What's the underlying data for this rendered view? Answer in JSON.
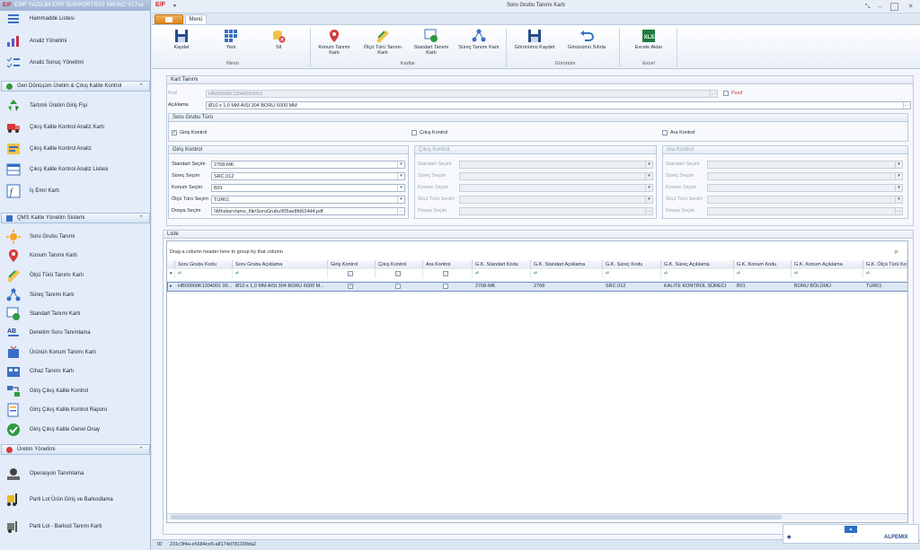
{
  "app": {
    "title": "EMF YAZILIM ERP SUPPORTSV2 MIKRO V17xx",
    "logo": "E/F"
  },
  "sidebar": {
    "top_items": [
      {
        "label": "Hammadde Listesi",
        "icon": "list-icon"
      },
      {
        "label": "Analiz Yönetimi",
        "icon": "chart-icon"
      },
      {
        "label": "Analiz Sonuç Yönetimi",
        "icon": "checklist-icon"
      }
    ],
    "groups": [
      {
        "label": "Geri Dönüşüm Üretim & Çıkış Kalite Kontrol",
        "items": [
          {
            "label": "Tartımlı Üretim Giriş Fişi",
            "icon": "recycle-icon"
          },
          {
            "label": "Çıkış Kalite Kontrol Analiz Kartı",
            "icon": "truck-icon"
          },
          {
            "label": "Çıkış Kalite Kontrol Analiz",
            "icon": "analysis-icon"
          },
          {
            "label": "Çıkış Kalite Kontrol Analiz Listesi",
            "icon": "table-icon"
          },
          {
            "label": "İş Emri Kartı",
            "icon": "formula-icon"
          }
        ]
      },
      {
        "label": "QMS Kalite Yönetim Sistemi",
        "items": [
          {
            "label": "Soru Grubu Tanımı",
            "icon": "sun-icon"
          },
          {
            "label": "Konum Tanımı Kartı",
            "icon": "location-icon"
          },
          {
            "label": "Ölçü Türü Tanımı Kartı",
            "icon": "ruler-icon"
          },
          {
            "label": "Süreç Tanımı Kartı",
            "icon": "share-icon"
          },
          {
            "label": "Standart Tanımı Kartı",
            "icon": "standard-icon"
          },
          {
            "label": "Denetim Soru Tanımlama",
            "icon": "ab-icon"
          },
          {
            "label": "Ürünün Konum Tanımı Kartı",
            "icon": "package-icon"
          },
          {
            "label": "Cihaz Tanımı Kartı",
            "icon": "device-icon"
          },
          {
            "label": "Giriş Çıkış Kalite Kontrol",
            "icon": "transfer-icon"
          },
          {
            "label": "Giriş Çıkış Kalite Kontrol Raporu",
            "icon": "report-icon"
          },
          {
            "label": "Giriş Çıkış Kalite Genel Onay",
            "icon": "approve-icon"
          }
        ]
      },
      {
        "label": "Üretim Yönetimi",
        "items": [
          {
            "label": "Operasyon Tanımlama",
            "icon": "operation-icon"
          },
          {
            "label": "Parti Lot Ürün Giriş ve Barkodlama",
            "icon": "forklift-icon"
          },
          {
            "label": "Parti Lot - Barkod Tanımı Kartı",
            "icon": "barcode-icon"
          }
        ]
      }
    ]
  },
  "window": {
    "title": "Soru Grubu Tanımı Kartı",
    "menu_tab": "Menü"
  },
  "ribbon": {
    "buttons": [
      {
        "label": "Kaydet",
        "icon": "save-icon"
      },
      {
        "label": "Yeni",
        "icon": "grid-new-icon"
      },
      {
        "label": "Sil",
        "icon": "delete-icon"
      },
      {
        "label": "Konum Tanımı Kartı",
        "icon": "location-icon"
      },
      {
        "label": "Ölçü Türü Tanımı Kartı",
        "icon": "ruler-icon"
      },
      {
        "label": "Standart Tanımı Kartı",
        "icon": "standard-icon"
      },
      {
        "label": "Süreç Tanımı Kartı",
        "icon": "share-icon"
      },
      {
        "label": "Görünümü Kaydet",
        "icon": "save-layout-icon"
      },
      {
        "label": "Görünümü Sıfırla",
        "icon": "undo-icon"
      },
      {
        "label": "Excele Aktar",
        "icon": "excel-icon"
      }
    ],
    "groups": [
      "Menü",
      "Kartlar",
      "Görünüm",
      "Excel"
    ]
  },
  "card": {
    "section_title": "Kart Tanımı",
    "kod_label": "Kod",
    "kod_value": "HB00000K13040010010",
    "pasif_label": "Pasif",
    "aciklama_label": "Açıklama",
    "aciklama_value": "Ø10 x 1,0 MM AISI 304 BORU 6000 MM",
    "type_title": "Soru Grubu Türü",
    "giris_label": "Giriş Kontrol",
    "cikis_label": "Çıkış Kontrol",
    "ara_label": "Ara Kontrol",
    "giris_checked": true,
    "cikis_checked": false,
    "ara_checked": false
  },
  "giris": {
    "title": "Giriş Kontrol",
    "rows": [
      {
        "label": "Standart Seçim",
        "value": "2768-MK"
      },
      {
        "label": "Süreç Seçim",
        "value": "SRC.012"
      },
      {
        "label": "Konum Seçim",
        "value": "B01"
      },
      {
        "label": "Ölçü Türü Seçim",
        "value": "TUR01"
      },
      {
        "label": "Dosya Seçim",
        "value": "\\\\Mhsbsrv\\qms_file\\SoruGrubu\\f05ae8fd624d4.pdf"
      }
    ]
  },
  "cikis": {
    "title": "Çıkış Kontrol",
    "rows": [
      "Standart Seçim",
      "Süreç Seçim",
      "Konum Seçim",
      "Ölçü Türü Seçim",
      "Dosya Seçim"
    ]
  },
  "ara": {
    "title": "Ara Kontrol",
    "rows": [
      "Standart Seçim",
      "Süreç Seçim",
      "Konum Seçim",
      "Ölçü Türü Seçim",
      "Dosya Seçim"
    ]
  },
  "list": {
    "title": "Liste",
    "group_hint": "Drag a column header here to group by that column",
    "columns": [
      "Soru Grubu Kodu",
      "Soru Grubu Açıklama",
      "Giriş Kontrol",
      "Çıkış Kontrol",
      "Ara Kontrol",
      "G.K. Standart Kodu",
      "G.K. Standart Açıklama",
      "G.K. Süreç Kodu",
      "G.K. Süreç Açıklama",
      "G.K. Konum Kodu",
      "G.K. Konum Açıklama",
      "G.K. Ölçü Türü Ko"
    ],
    "row": [
      "HB00000K1304001 00...",
      "Ø10 x 1,0 MM AISI 304 BORU 6000 M...",
      "",
      "",
      "",
      "2768-MK",
      "2768",
      "SRC.012",
      "KALITE KONTROL SÜRECI",
      "B01",
      "BORU BÖLÜMÜ",
      "TUR01"
    ]
  },
  "status": {
    "id_label": "ID",
    "id_value": "231c3f4a-e5684ce5-a8174d781199da2",
    "brand": "ALPEMIX"
  }
}
